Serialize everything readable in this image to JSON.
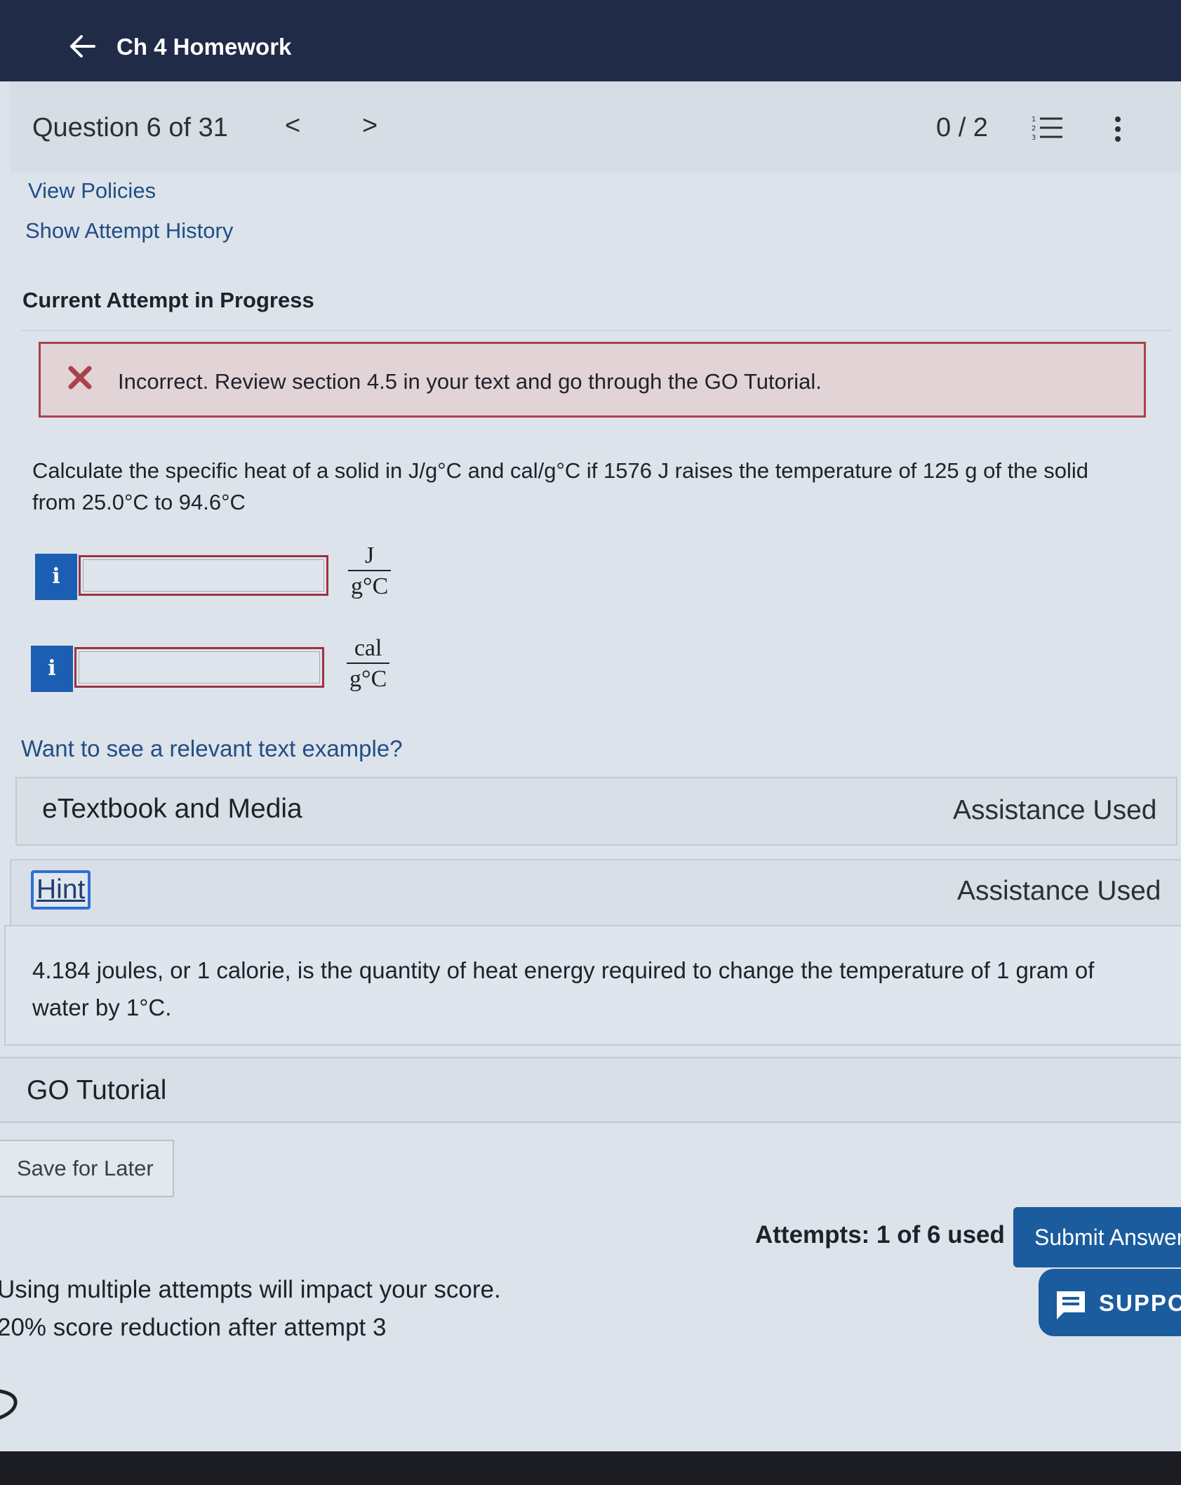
{
  "topbar": {
    "title": "Ch 4 Homework"
  },
  "question_header": {
    "label": "Question 6 of 31",
    "prev": "<",
    "next": ">",
    "score": "0 / 2"
  },
  "links": {
    "view_policies": "View Policies",
    "attempt_history": "Show Attempt History"
  },
  "attempt_heading": "Current Attempt in Progress",
  "feedback": {
    "message": "Incorrect. Review section 4.5 in your text and go through the GO Tutorial."
  },
  "question_text": "Calculate the specific heat of a solid in J/g°C and cal/g°C if 1576 J raises the temperature of 125 g of the solid from 25.0°C to 94.6°C",
  "answers": [
    {
      "info": "i",
      "value": "",
      "unit_num": "J",
      "unit_den": "g°C"
    },
    {
      "info": "i",
      "value": "",
      "unit_num": "cal",
      "unit_den": "g°C"
    }
  ],
  "example_link": "Want to see a relevant text example?",
  "panels": {
    "etextbook": {
      "label": "eTextbook and Media",
      "status": "Assistance Used"
    },
    "hint": {
      "label": "Hint",
      "status": "Assistance Used",
      "text": "4.184 joules, or 1 calorie, is the quantity of heat energy required to change the temperature of 1 gram of water by 1°C."
    },
    "go_tutorial": {
      "label": "GO Tutorial"
    }
  },
  "save_label": "Save for Later",
  "attempts": "Attempts: 1 of 6 used",
  "submit_label": "Submit Answer",
  "warning": {
    "line1": "Using multiple attempts will impact your score.",
    "line2": "20% score reduction after attempt 3"
  },
  "support_label": "SUPPORT",
  "colors": {
    "nav_bar": "#1f2b47",
    "primary_button": "#1b5c9e",
    "error": "#a9424c",
    "link": "#1f4e86"
  }
}
